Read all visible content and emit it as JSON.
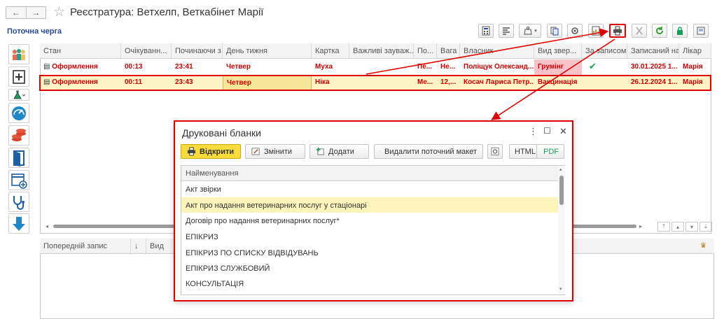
{
  "window": {
    "title": "Реєстратура:  Ветхелп, Веткабінет Марії",
    "subtitle": "Поточна черга",
    "back_glyph": "←",
    "forward_glyph": "→"
  },
  "grid": {
    "columns": [
      "Стан",
      "Очікуванн...",
      "Починаючи з",
      "День тижня",
      "Картка",
      "Важливі зауваж...",
      "По...",
      "Вага",
      "Власник",
      "Вид звер...",
      "За записом",
      "Записаний на",
      "Лікар"
    ],
    "rows": [
      [
        "Оформлення",
        "00:13",
        "23:41",
        "Четвер",
        "Муха",
        "",
        "Пе...",
        "Не...",
        "Поліщук Олександ...",
        "Грумінг",
        "✔",
        "30.01.2025 1...",
        "Марія"
      ],
      [
        "Оформлення",
        "00:11",
        "23:43",
        "Четвер",
        "Ніка",
        "",
        "Ме...",
        "12,...",
        "Косач Лариса Петр...",
        "Вакцинація",
        "",
        "26.12.2024 1...",
        "Марія"
      ]
    ]
  },
  "lower_grid": {
    "columns": [
      "Попередній запис",
      "↓",
      "Вид"
    ]
  },
  "dialog": {
    "title": "Друковані бланки",
    "buttons": {
      "open": "Відкрити",
      "change": "Змінити",
      "add": "Додати",
      "delete_layout": "Видалити поточний макет",
      "html": "HTML",
      "pdf": "PDF"
    },
    "list_header": "Найменування",
    "items": [
      "Акт звірки",
      "Акт про надання ветеринарних послуг у стаціонарі",
      "Договір про надання ветеринарних послуг*",
      "ЕПІКРИЗ",
      "ЕПІКРИЗ ПО СПИСКУ ВІДВІДУВАНЬ",
      "ЕПІКРИЗ СЛУЖБОВИЙ",
      "КОНСУЛЬТАЦІЯ"
    ]
  },
  "colors": {
    "accent_red": "#e00000",
    "row_text_red": "#d30000",
    "title_blue": "#2a4a98",
    "open_button_yellow": "#f8dc3c"
  }
}
